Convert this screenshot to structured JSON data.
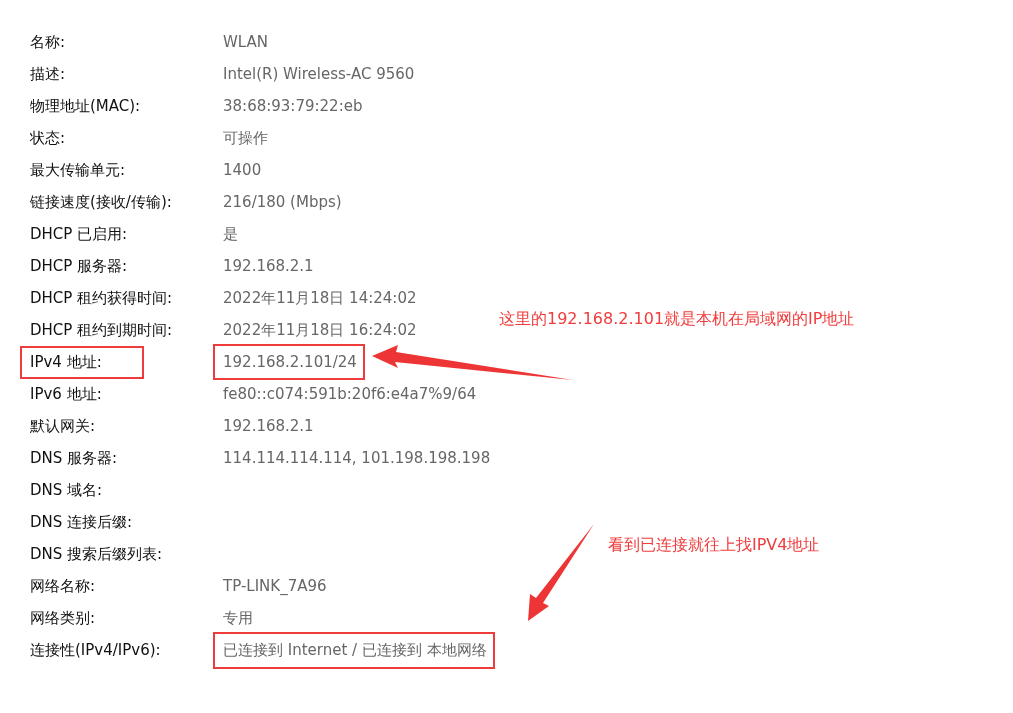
{
  "properties": [
    {
      "label": "名称:",
      "value": "WLAN"
    },
    {
      "label": "描述:",
      "value": "Intel(R) Wireless-AC 9560"
    },
    {
      "label": "物理地址(MAC):",
      "value": "38:68:93:79:22:eb"
    },
    {
      "label": "状态:",
      "value": "可操作"
    },
    {
      "label": "最大传输单元:",
      "value": "1400"
    },
    {
      "label": "链接速度(接收/传输):",
      "value": "216/180 (Mbps)"
    },
    {
      "label": "DHCP 已启用:",
      "value": "是"
    },
    {
      "label": "DHCP 服务器:",
      "value": "192.168.2.1"
    },
    {
      "label": "DHCP 租约获得时间:",
      "value": "2022年11月18日 14:24:02"
    },
    {
      "label": "DHCP 租约到期时间:",
      "value": "2022年11月18日 16:24:02"
    },
    {
      "label": "IPv4 地址:",
      "value": "192.168.2.101/24",
      "label_highlighted": true,
      "value_highlighted": true
    },
    {
      "label": "IPv6 地址:",
      "value": "fe80::c074:591b:20f6:e4a7%9/64"
    },
    {
      "label": "默认网关:",
      "value": "192.168.2.1"
    },
    {
      "label": "DNS 服务器:",
      "value": "114.114.114.114, 101.198.198.198"
    },
    {
      "label": "DNS 域名:"
    },
    {
      "label": "DNS 连接后缀:"
    },
    {
      "label": "DNS 搜索后缀列表:"
    },
    {
      "label": "网络名称:",
      "value": "TP-LINK_7A96"
    },
    {
      "label": "网络类别:",
      "value": "专用"
    },
    {
      "label": "连接性(IPv4/IPv6):",
      "value": "已连接到 Internet / 已连接到 本地网络",
      "value_highlighted": true
    }
  ],
  "annotations": [
    {
      "text": "这里的192.168.2.101就是本机在局域网的IP地址"
    },
    {
      "text": "看到已连接就往上找IPV4地址"
    }
  ]
}
